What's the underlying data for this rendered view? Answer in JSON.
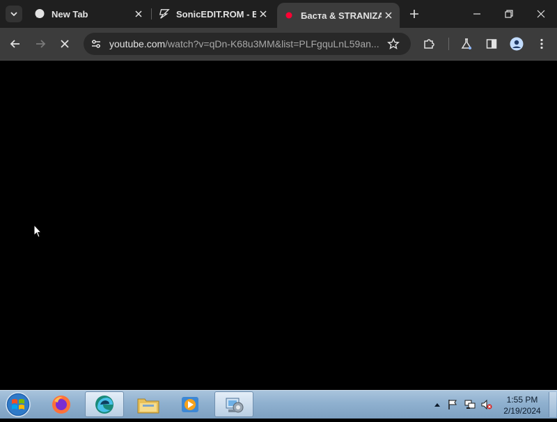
{
  "browser": {
    "tabs": [
      {
        "title": "New Tab",
        "favicon": "chat-bubble-icon"
      },
      {
        "title": "SonicEDIT.ROM - EY",
        "favicon": "sonicedit-logo-icon"
      },
      {
        "title": "Баста & STRANIZA",
        "favicon": "youtube-icon",
        "active": true
      }
    ],
    "url_domain": "youtube.com",
    "url_rest": "/watch?v=qDn-K68u3MM&list=PLFgquLnL59an...",
    "page_loading": true
  },
  "taskbar": {
    "apps": [
      "start-orb",
      "firefox",
      "edge",
      "file-explorer",
      "media-player",
      "control-panel"
    ],
    "active_app": "edge",
    "time": "1:55 PM",
    "date": "2/19/2024"
  },
  "colors": {
    "tabstrip": "#1f1f1f",
    "toolbar": "#3c3c3c",
    "content": "#000000",
    "taskbar": "#8fb0cf"
  }
}
